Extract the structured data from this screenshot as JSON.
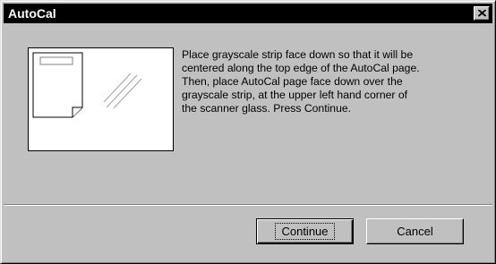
{
  "window": {
    "title": "AutoCal",
    "close_icon": "close-icon"
  },
  "dialog": {
    "illustration": "scanner-glass-icon",
    "message": "Place grayscale strip face down so that it will be\ncentered along the top edge of the AutoCal page.\nThen, place AutoCal page face down over the\ngrayscale strip, at the upper left hand corner of\nthe scanner glass. Press Continue."
  },
  "buttons": {
    "continue_label": "Continue",
    "cancel_label": "Cancel"
  },
  "colors": {
    "titlebar": "#000000",
    "face": "#c0c0c0",
    "title_text": "#ffffff"
  }
}
